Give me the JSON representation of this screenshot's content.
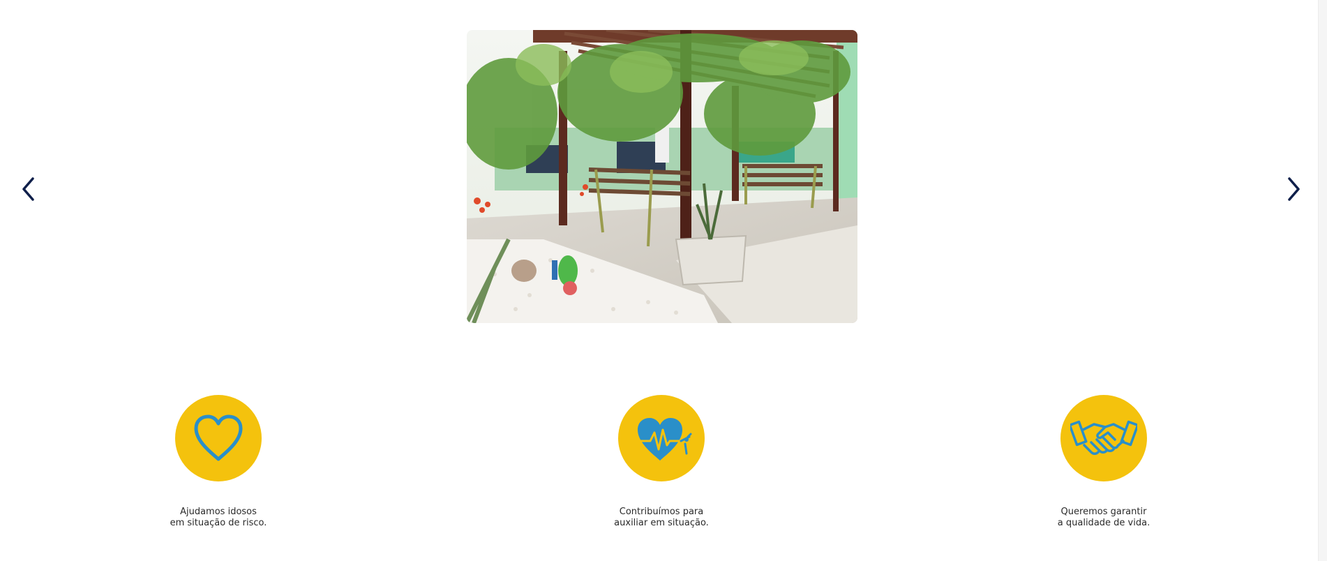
{
  "colors": {
    "accent_yellow": "#f4c20d",
    "icon_blue": "#2a8fc9",
    "arrow_navy": "#0f1f4a",
    "text": "#2a2a2a"
  },
  "carousel": {
    "prev_icon": "chevron-left-icon",
    "next_icon": "chevron-right-icon",
    "slide_image": "garden-pergola-photo"
  },
  "features": [
    {
      "icon": "heart-icon",
      "line1": "Ajudamos idosos",
      "line2": "em situação de risco."
    },
    {
      "icon": "heart-pulse-icon",
      "line1": "Contribuímos para",
      "line2": "auxiliar em situação."
    },
    {
      "icon": "handshake-icon",
      "line1": "Queremos garantir",
      "line2": "a qualidade de vida."
    }
  ]
}
